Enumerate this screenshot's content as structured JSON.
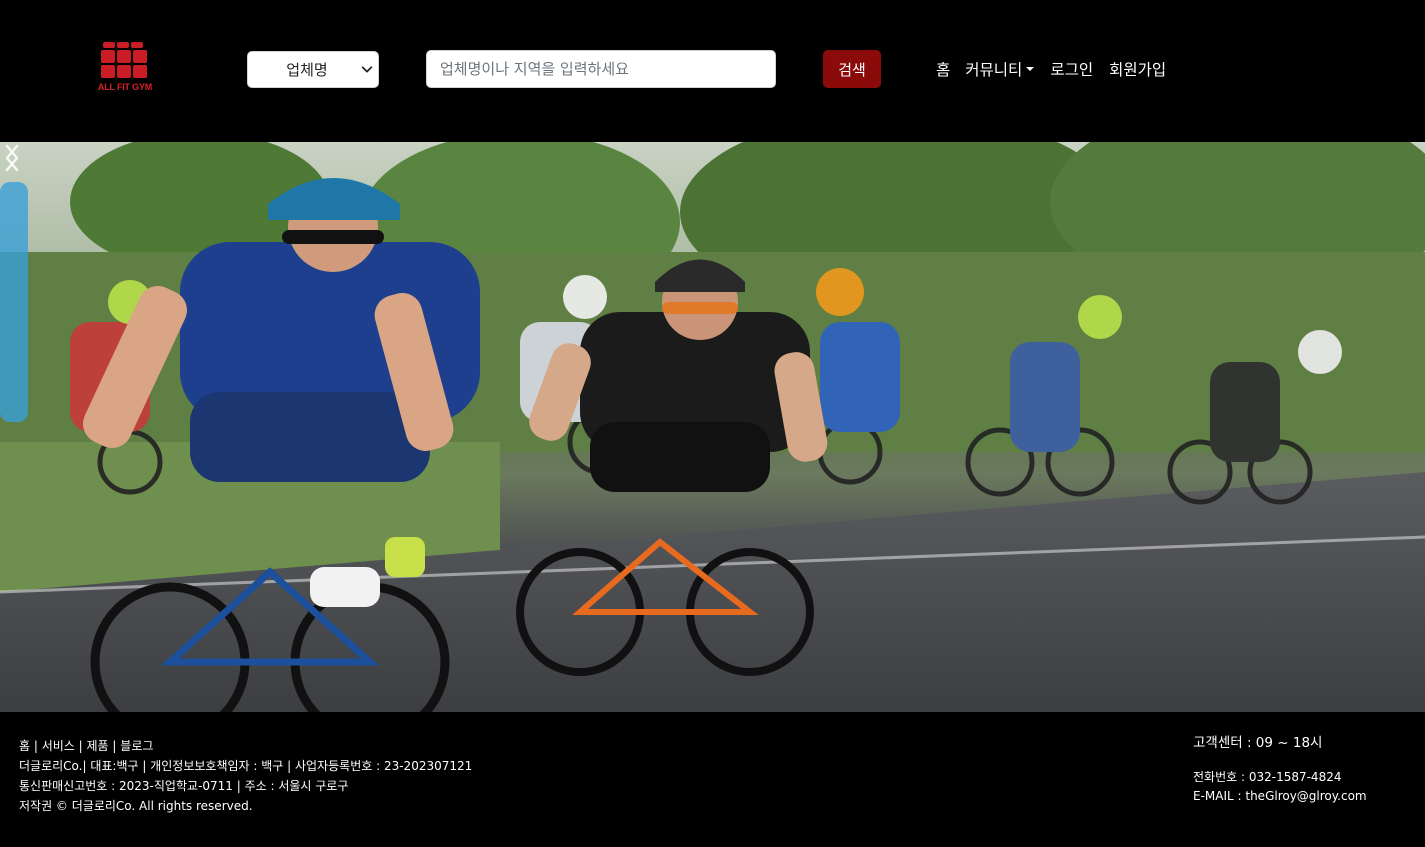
{
  "header": {
    "logo_text": "ALL FIT GYM",
    "select": {
      "selected": "업체명",
      "icon": "chevron-down-icon"
    },
    "search": {
      "placeholder": "업체명이나 지역을 입력하세요",
      "value": ""
    },
    "search_button": "검색",
    "nav": {
      "home": "홈",
      "community": "커뮤니티",
      "login": "로그인",
      "signup": "회원가입"
    }
  },
  "hero": {
    "image": "cyclists-racing-peloton",
    "prev_icon": "chevron-left-icon",
    "next_icon": "chevron-right-icon"
  },
  "footer": {
    "links": [
      "홈",
      "서비스",
      "제품",
      "블로그"
    ],
    "separator": " | ",
    "company_line": "더글로리Co.| 대표:백구 | 개인정보보호책임자 : 백구 | 사업자등록번호 : 23-202307121",
    "registration_line": "통신판매신고번호 : 2023-직업학교-0711 | 주소 : 서울시 구로구",
    "copyright": "저작권 © 더글로리Co. All rights reserved.",
    "customer_center": "고객센터 : 09 ~ 18시",
    "phone": "전화번호 : 032-1587-4824",
    "email": "E-MAIL : theGlroy@glroy.com"
  },
  "colors": {
    "background": "#000000",
    "brand_red": "#c91c24",
    "search_button": "#8b0b0b"
  }
}
